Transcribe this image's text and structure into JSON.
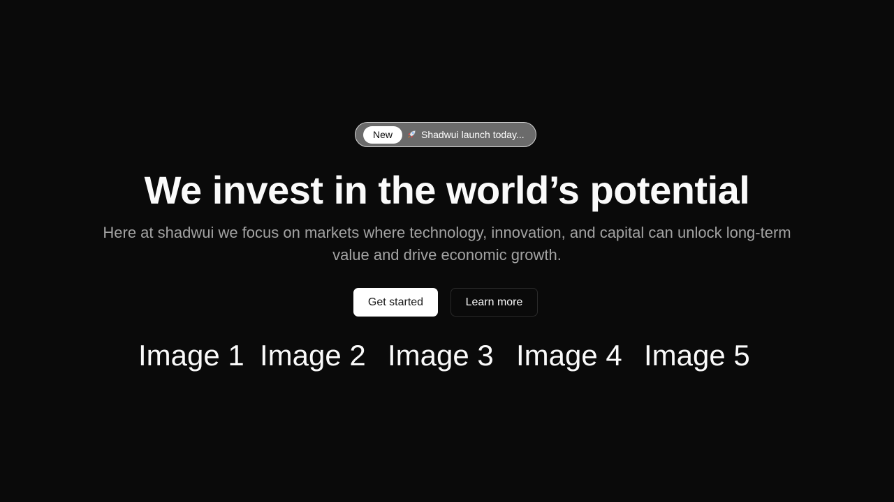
{
  "announcement": {
    "badge": "New",
    "icon": "rocket-icon",
    "text": "Shadwui launch today..."
  },
  "hero": {
    "title": "We invest in the world’s potential",
    "subtitle": "Here at shadwui we focus on markets where technology, innovation, and capital can unlock long-term value and drive economic growth."
  },
  "buttons": {
    "primary": "Get started",
    "secondary": "Learn more"
  },
  "images": [
    "Image 1",
    "Image 2",
    "Image 3",
    "Image 4",
    "Image 5"
  ],
  "colors": {
    "background": "#0a0a0a",
    "foreground": "#fafafa",
    "muted": "#a3a3a3",
    "announce_bg": "#6b6b6b"
  }
}
